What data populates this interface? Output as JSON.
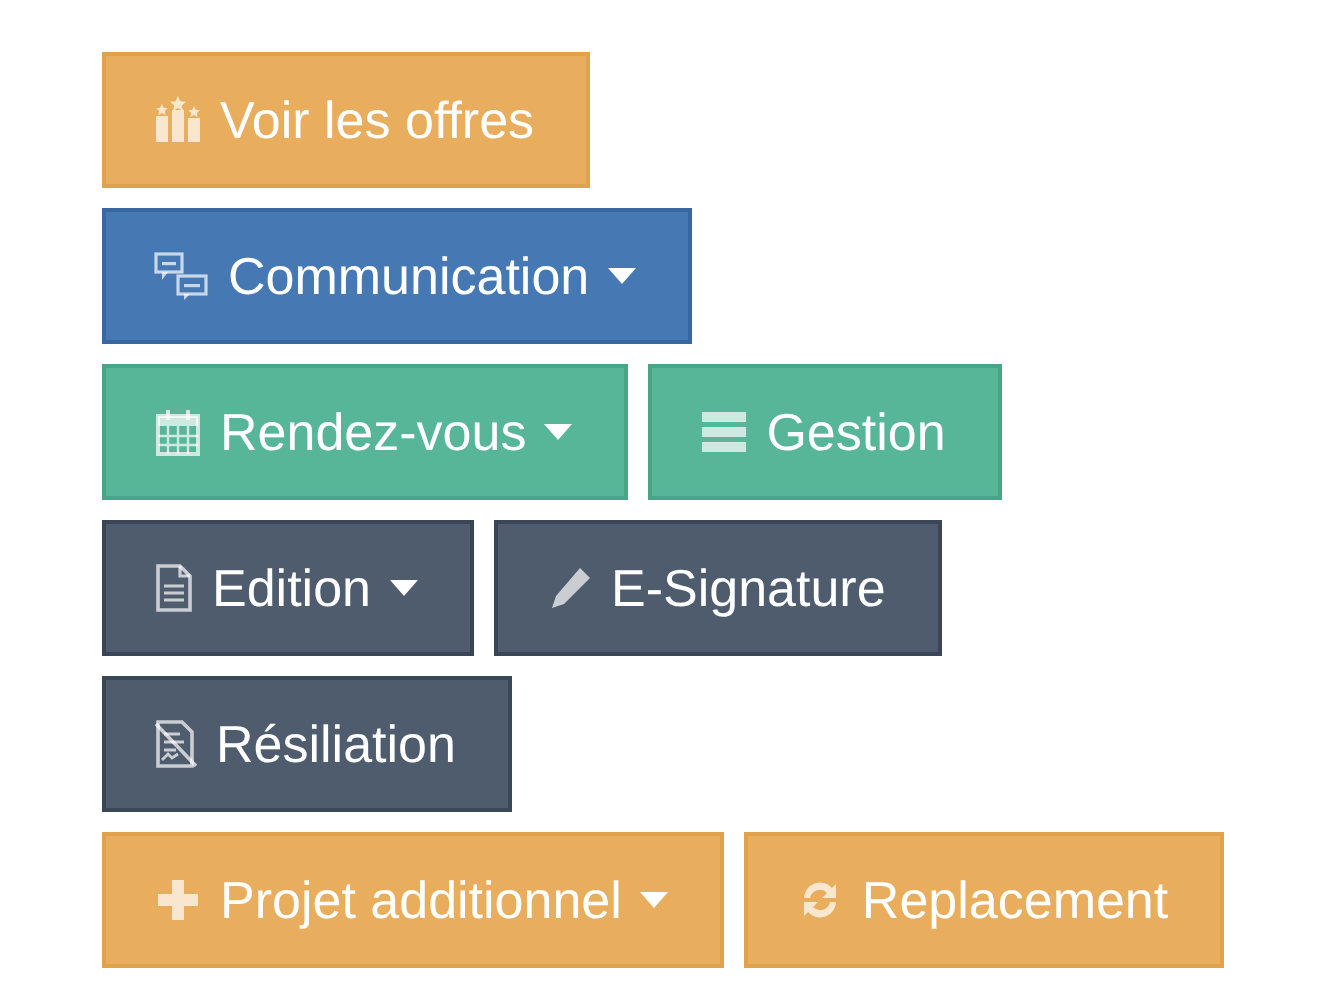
{
  "rows": [
    {
      "buttons": [
        {
          "label": "Voir les offres",
          "kind": "warning",
          "has_menu": false
        }
      ]
    },
    {
      "buttons": [
        {
          "label": "Communication",
          "kind": "primary",
          "has_menu": true
        }
      ]
    },
    {
      "buttons": [
        {
          "label": "Rendez-vous",
          "kind": "success",
          "has_menu": true
        },
        {
          "label": "Gestion",
          "kind": "success",
          "has_menu": false
        }
      ]
    },
    {
      "buttons": [
        {
          "label": "Edition",
          "kind": "dark",
          "has_menu": true
        },
        {
          "label": "E-Signature",
          "kind": "dark",
          "has_menu": false
        }
      ]
    },
    {
      "buttons": [
        {
          "label": "Résiliation",
          "kind": "dark",
          "has_menu": false
        }
      ]
    },
    {
      "buttons": [
        {
          "label": "Projet additionnel",
          "kind": "warning",
          "has_menu": true
        },
        {
          "label": "Replacement",
          "kind": "warning",
          "has_menu": false
        }
      ]
    }
  ]
}
